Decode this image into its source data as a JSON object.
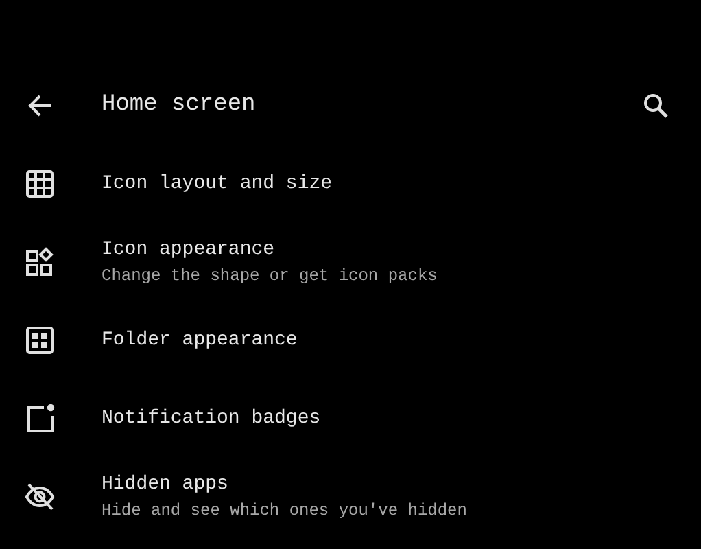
{
  "header": {
    "title": "Home screen"
  },
  "items": [
    {
      "title": "Icon layout and size"
    },
    {
      "title": "Icon appearance",
      "subtitle": "Change the shape or get icon packs"
    },
    {
      "title": "Folder appearance"
    },
    {
      "title": "Notification badges"
    },
    {
      "title": "Hidden apps",
      "subtitle": "Hide and see which ones you've hidden"
    }
  ]
}
